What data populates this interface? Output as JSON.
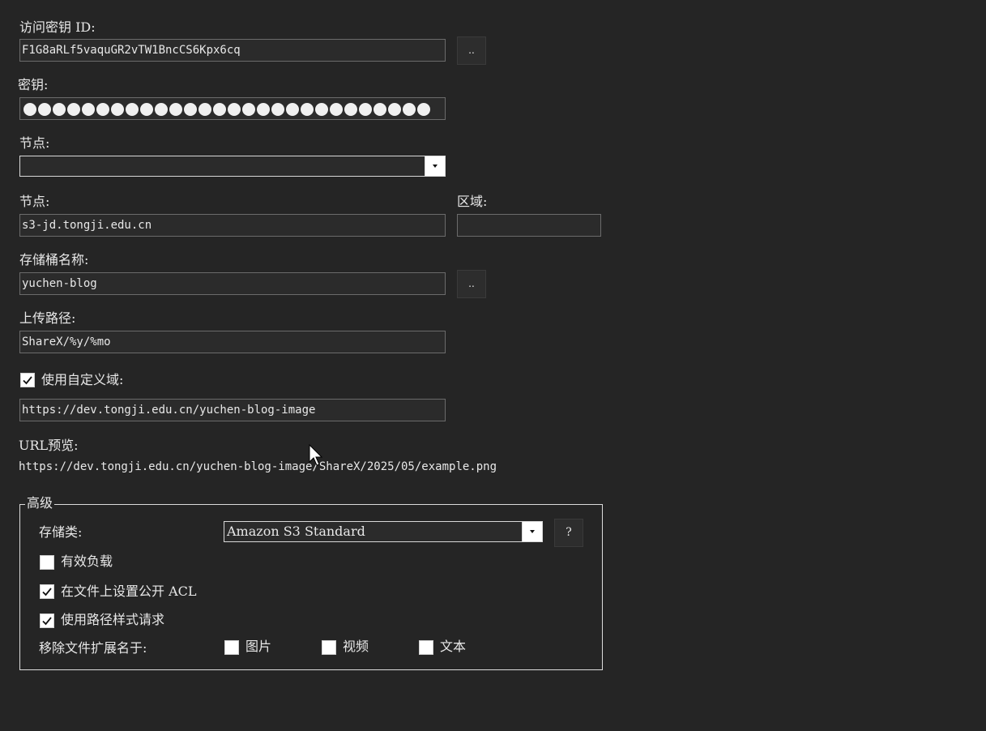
{
  "access_key": {
    "label": "访问密钥 ID:",
    "value": "F1G8aRLf5vaquGR2vTW1BncCS6Kpx6cq",
    "browse_label": ".."
  },
  "secret_key": {
    "label": "密钥:"
  },
  "endpoint_select": {
    "label": "节点:",
    "value": ""
  },
  "endpoint": {
    "label": "节点:",
    "value": "s3-jd.tongji.edu.cn"
  },
  "region": {
    "label": "区域:",
    "value": ""
  },
  "bucket": {
    "label": "存储桶名称:",
    "value": "yuchen-blog",
    "browse_label": ".."
  },
  "upload_path": {
    "label": "上传路径:",
    "value": "ShareX/%y/%mo"
  },
  "custom_domain": {
    "checkbox_label": "使用自定义域:",
    "checked": true,
    "value": "https://dev.tongji.edu.cn/yuchen-blog-image"
  },
  "url_preview": {
    "label": "URL预览:",
    "value": "https://dev.tongji.edu.cn/yuchen-blog-image/ShareX/2025/05/example.png"
  },
  "advanced": {
    "title": "高级",
    "storage_class_label": "存储类:",
    "storage_class_value": "Amazon S3 Standard",
    "help_label": "?",
    "payload_label": "有效负载",
    "payload_checked": false,
    "public_acl_label": "在文件上设置公开 ACL",
    "public_acl_checked": true,
    "path_style_label": "使用路径样式请求",
    "path_style_checked": true,
    "remove_ext_label": "移除文件扩展名于:",
    "remove_ext_options": [
      {
        "label": "图片",
        "checked": false
      },
      {
        "label": "视频",
        "checked": false
      },
      {
        "label": "文本",
        "checked": false
      }
    ]
  },
  "colors": {
    "background": "#252525",
    "input_background": "#2b2b2b",
    "text": "#e6e6e6"
  }
}
